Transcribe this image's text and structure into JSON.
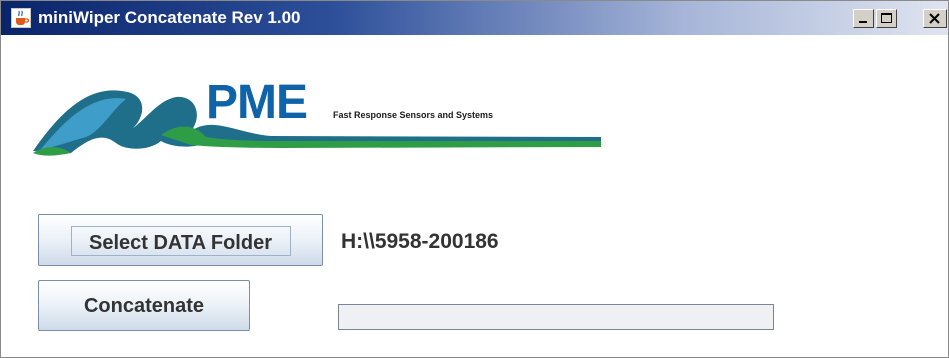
{
  "window": {
    "title": "miniWiper Concatenate Rev 1.00",
    "icon": "java-cup-icon",
    "controls": [
      "minimize-icon",
      "maximize-icon",
      "close-icon"
    ]
  },
  "logo": {
    "brand": "PME",
    "tagline": "Fast Response Sensors and Systems",
    "graphic": "wave-logo"
  },
  "select_button": {
    "label": "Select DATA Folder"
  },
  "folder_path": "H:\\\\5958-200186",
  "concatenate_button": {
    "label": "Concatenate"
  },
  "progress": {
    "fraction": 0
  },
  "colors": {
    "titlebar_start": "#0a246a",
    "titlebar_end": "#dfe4ef",
    "logo_blue": "#0f63a8",
    "logo_green": "#2e9d46",
    "button_border": "#7a8fa8",
    "progress_border": "#7a8597"
  }
}
